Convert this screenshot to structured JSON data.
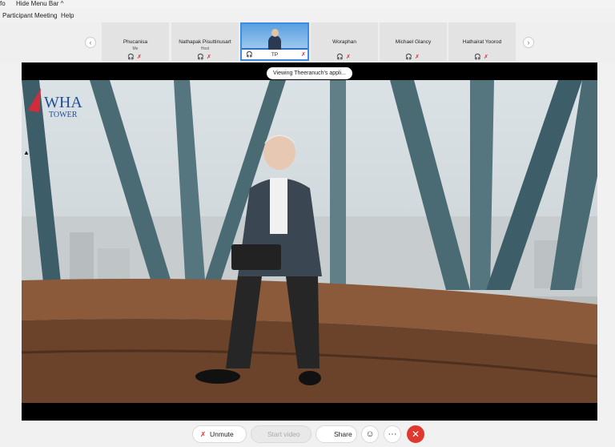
{
  "top": {
    "fragment": "fo",
    "hide_menu_bar": "Hide Menu Bar"
  },
  "menu": {
    "items": [
      "Participant",
      "Meeting",
      "Help"
    ]
  },
  "participants": [
    {
      "name": "Phucanisa",
      "role": "Me"
    },
    {
      "name": "Nathapak Pisuttinusart",
      "role": "Host"
    },
    {
      "name": "TP",
      "role": ""
    },
    {
      "name": "Woraphan",
      "role": ""
    },
    {
      "name": "Michael Glancy",
      "role": ""
    },
    {
      "name": "Hathairat Yoorod",
      "role": ""
    }
  ],
  "icons": {
    "prev": "‹",
    "next": "›",
    "chevron_up": "^",
    "mic": "🎧",
    "muted_mic": "✗",
    "reactions": "☺",
    "more": "···",
    "leave": "✕",
    "cursor": "▲"
  },
  "stage": {
    "viewing_label": "Viewing Theeranuch's appli...",
    "brand": {
      "mark": "WHA",
      "sub": "TOWER"
    }
  },
  "controls": {
    "unmute": "Unmute",
    "start_video": "Start video",
    "share": "Share"
  },
  "colors": {
    "leave": "#e0382f",
    "accent": "#3c8ce6",
    "muted": "#d33"
  }
}
